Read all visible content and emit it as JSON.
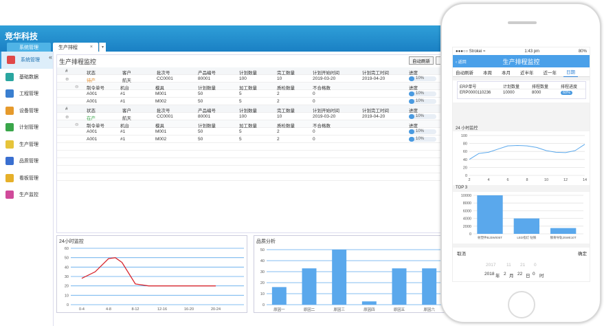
{
  "app": {
    "brand": "竞华科技",
    "tab_system": "系统管理",
    "tab_production": "生产排程",
    "tab_close": "×",
    "collapse": "«"
  },
  "sidebar": {
    "items": [
      {
        "label": "系统管理",
        "icon": "gear-icon",
        "color": "#e04848"
      },
      {
        "label": "基础数据",
        "icon": "cube-icon",
        "color": "#2aa6a0"
      },
      {
        "label": "工程管理",
        "icon": "box-icon",
        "color": "#3a7fd0"
      },
      {
        "label": "设备管理",
        "icon": "equipment-icon",
        "color": "#e69a2c"
      },
      {
        "label": "计划管理",
        "icon": "plan-icon",
        "color": "#3aa64a"
      },
      {
        "label": "生产管理",
        "icon": "clipboard-icon",
        "color": "#e6c43a"
      },
      {
        "label": "品质管理",
        "icon": "quality-icon",
        "color": "#3a6fd0"
      },
      {
        "label": "看板管理",
        "icon": "board-icon",
        "color": "#e6b02a"
      },
      {
        "label": "生产监控",
        "icon": "monitor-icon",
        "color": "#d04a9a"
      }
    ]
  },
  "main": {
    "title": "生产排程监控",
    "btn_refresh": "自动刷新",
    "btn_more": "本",
    "header": [
      "#",
      "状态",
      "客户",
      "批次号",
      "产品编号",
      "计划数量",
      "完工数量",
      "计划开始时间",
      "计划完工时间",
      "进度"
    ],
    "subheader": [
      "制令单号",
      "机台",
      "模具",
      "计划数量",
      "加工数量",
      "质检数量",
      "不合格数",
      "进度"
    ],
    "groups": [
      {
        "status": "待产",
        "status_color": "#e08a2a",
        "customer": "航天",
        "batch": "CC0001",
        "product": "80001",
        "plan": "100",
        "done": "10",
        "start": "2019-03-20",
        "end": "2019-04-20",
        "progress": "10%",
        "rows": [
          [
            "A001",
            "#1",
            "M001",
            "50",
            "5",
            "2",
            "0",
            "10%"
          ],
          [
            "A001",
            "#1",
            "M002",
            "50",
            "5",
            "2",
            "0",
            "10%"
          ]
        ]
      },
      {
        "status": "在产",
        "status_color": "#3aa64a",
        "customer": "航天",
        "batch": "CC0001",
        "product": "80001",
        "plan": "100",
        "done": "10",
        "start": "2019-03-20",
        "end": "2019-04-20",
        "progress": "10%",
        "rows": [
          [
            "A001",
            "#1",
            "M001",
            "50",
            "5",
            "2",
            "0",
            "10%"
          ],
          [
            "A001",
            "#1",
            "M002",
            "50",
            "5",
            "2",
            "0",
            "10%"
          ]
        ]
      }
    ]
  },
  "chart_data": [
    {
      "type": "line",
      "title": "24小时监控",
      "categories": [
        "0-4",
        "4-8",
        "8-12",
        "12-16",
        "16-20",
        "20-24"
      ],
      "ylim": [
        0,
        60
      ],
      "yticks": [
        "0",
        "10",
        "20",
        "30",
        "40",
        "50",
        "60"
      ],
      "x": [
        0,
        0.5,
        1,
        1.25,
        1.5,
        2,
        2.5,
        3,
        4,
        5
      ],
      "values": [
        28,
        35,
        49,
        50,
        45,
        22,
        20,
        20,
        20,
        20
      ],
      "line_color": "#d8262e"
    },
    {
      "type": "bar",
      "title": "品质分析",
      "categories": [
        "原因一",
        "原因二",
        "原因三",
        "原因四",
        "原因五",
        "原因六"
      ],
      "ylim": [
        0,
        50
      ],
      "yticks": [
        "0",
        "10",
        "20",
        "30",
        "40",
        "50"
      ],
      "values": [
        16,
        33,
        50,
        3,
        33,
        33
      ],
      "bar_color": "#5aa8ec"
    },
    {
      "type": "line",
      "title": "24 小时监控",
      "x": [
        2,
        4,
        6,
        8,
        10,
        12,
        14
      ],
      "xticks": [
        "2",
        "4",
        "6",
        "8",
        "10",
        "12",
        "14"
      ],
      "ylim": [
        0,
        100
      ],
      "yticks": [
        "0",
        "20",
        "40",
        "60",
        "80",
        "100"
      ],
      "points_x": [
        2,
        3,
        4,
        5,
        6,
        7,
        8,
        9,
        10,
        11,
        12,
        13,
        14
      ],
      "points_y": [
        40,
        55,
        58,
        66,
        74,
        75,
        74,
        70,
        62,
        58,
        57,
        62,
        78
      ],
      "line_color": "#5aa8ec"
    },
    {
      "type": "bar",
      "title": "TOP 3",
      "categories": [
        "射塑件BJ3W005T",
        "LED指灯 钻铁",
        "钢骨导轨25WE10T"
      ],
      "ylim": [
        0,
        10000
      ],
      "yticks": [
        "0",
        "2000",
        "4000",
        "6000",
        "8000",
        "10000"
      ],
      "values": [
        10000,
        4000,
        1500
      ],
      "bar_color": "#5aa8ec"
    }
  ],
  "phone": {
    "carrier": "●●●○○ Strokei",
    "wifi": "≈",
    "time": "1:43 pm",
    "battery": "80%",
    "back": "返回",
    "title": "生产排程监控",
    "tabs": [
      "自动刷新",
      "本周",
      "本月",
      "近半年",
      "近一年",
      "日期"
    ],
    "card_header": [
      "ERP单号",
      "计划数量",
      "排程数量",
      "排程进度"
    ],
    "card_row": [
      "ERP0000110236",
      "10000",
      "8000",
      "60%"
    ],
    "cancel": "取消",
    "confirm": "确定",
    "picker_faded": [
      "2017",
      "11",
      "21",
      "0"
    ],
    "picker": [
      "2018",
      "年",
      "2",
      "月",
      "22",
      "日",
      "0",
      "时"
    ]
  }
}
